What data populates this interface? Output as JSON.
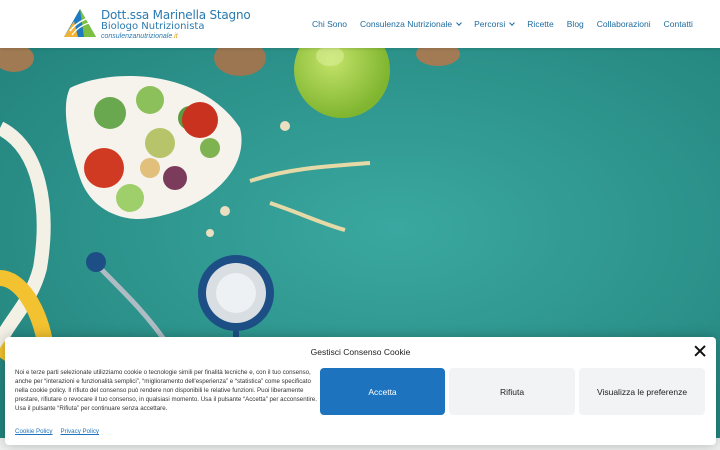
{
  "logo": {
    "name": "Dott.ssa Marinella Stagno",
    "title": "Biologo Nutrizionista",
    "url_main": "consulenzanutrizionale",
    "url_tld": ".it"
  },
  "nav": {
    "items": [
      {
        "label": "Chi Sono",
        "has_dropdown": false
      },
      {
        "label": "Consulenza Nutrizionale",
        "has_dropdown": true
      },
      {
        "label": "Percorsi",
        "has_dropdown": true
      },
      {
        "label": "Ricette",
        "has_dropdown": false
      },
      {
        "label": "Blog",
        "has_dropdown": false
      },
      {
        "label": "Collaborazioni",
        "has_dropdown": false
      },
      {
        "label": "Contatti",
        "has_dropdown": false
      }
    ]
  },
  "cookie": {
    "title": "Gestisci Consenso Cookie",
    "text": "Noi e terze parti selezionate utilizziamo cookie o tecnologie simili per finalità tecniche e, con il tuo consenso, anche per “interazioni e funzionalità semplici”, “miglioramento dell'esperienza” e “statistica” come specificato nella cookie policy. Il rifiuto del consenso può rendere non disponibili le relative funzioni. Puoi liberamente prestare, rifiutare o revocare il tuo consenso, in qualsiasi momento. Usa il pulsante “Accetta” per acconsentire. Usa il pulsante “Rifiuta” per continuare senza accettare.",
    "accept_label": "Accetta",
    "deny_label": "Rifiuta",
    "prefs_label": "Visualizza le preferenze",
    "cookie_policy_label": "Cookie Policy",
    "privacy_policy_label": "Privacy Policy"
  },
  "colors": {
    "brand_blue": "#1e73be",
    "hero_teal": "#2f9a93",
    "logo_accent": "#e0a020"
  },
  "icons": {
    "close": "close-icon",
    "dropdown": "chevron-down-icon"
  }
}
